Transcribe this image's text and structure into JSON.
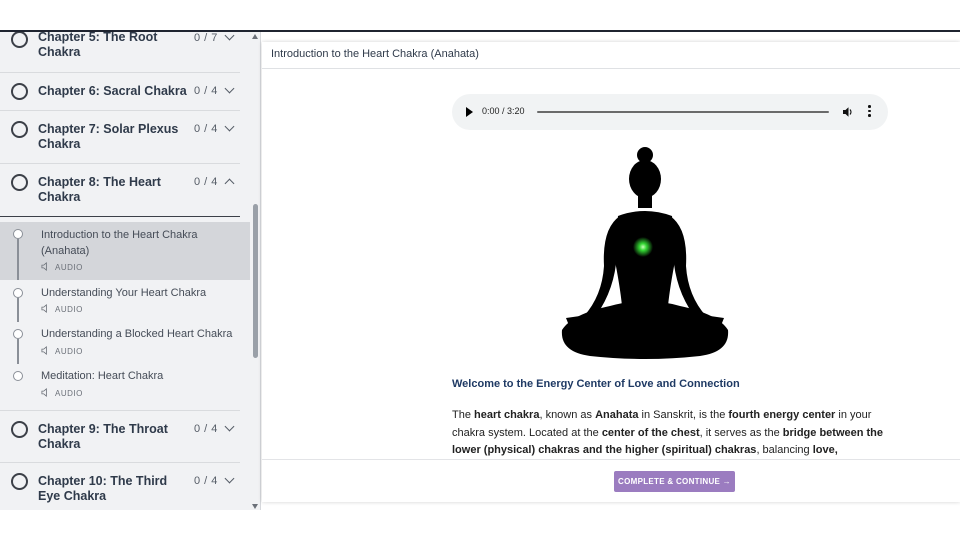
{
  "sidebar": {
    "chapters": [
      {
        "title": "Chapter 5: The Root Chakra",
        "count": "0 / 7"
      },
      {
        "title": "Chapter 6: Sacral Chakra",
        "count": "0 / 4"
      },
      {
        "title": "Chapter 7: Solar Plexus Chakra",
        "count": "0 / 4"
      },
      {
        "title": "Chapter 8: The Heart Chakra",
        "count": "0 / 4"
      },
      {
        "title": "Chapter 9: The Throat Chakra",
        "count": "0 / 4"
      },
      {
        "title": "Chapter 10: The Third Eye Chakra",
        "count": "0 / 4"
      }
    ],
    "lessons": [
      {
        "title": "Introduction to the Heart Chakra (Anahata)",
        "type": "AUDIO"
      },
      {
        "title": "Understanding Your Heart Chakra",
        "type": "AUDIO"
      },
      {
        "title": "Understanding a Blocked Heart Chakra",
        "type": "AUDIO"
      },
      {
        "title": "Meditation: Heart Chakra",
        "type": "AUDIO"
      }
    ]
  },
  "content": {
    "header_title": "Introduction to the Heart Chakra (Anahata)",
    "audio": {
      "time": "0:00 / 3:20",
      "progress": 0
    },
    "article_heading": "Welcome to the Energy Center of Love and Connection",
    "paragraph": [
      {
        "text": "The ",
        "bold": false
      },
      {
        "text": "heart chakra",
        "bold": true
      },
      {
        "text": ", known as ",
        "bold": false
      },
      {
        "text": "Anahata",
        "bold": true
      },
      {
        "text": " in Sanskrit, is the ",
        "bold": false
      },
      {
        "text": "fourth energy center",
        "bold": true
      },
      {
        "text": " in your chakra system. Located at the ",
        "bold": false
      },
      {
        "text": "center of the chest",
        "bold": true
      },
      {
        "text": ", it serves as the ",
        "bold": false
      },
      {
        "text": "bridge between the lower (physical) chakras and the higher (spiritual) chakras",
        "bold": true
      },
      {
        "text": ", balancing ",
        "bold": false
      },
      {
        "text": "love,",
        "bold": true
      }
    ],
    "cta_label": "COMPLETE & CONTINUE →"
  },
  "colors": {
    "accent": "#9b7cc0",
    "heading": "#1f3a64",
    "heart_glow": "#33d633"
  }
}
